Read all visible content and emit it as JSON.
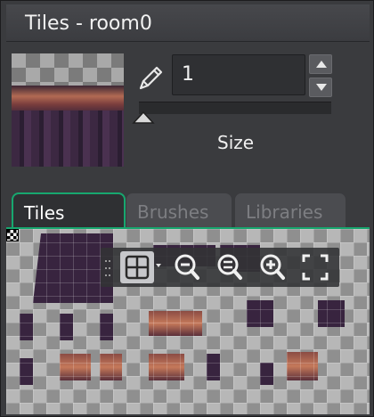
{
  "window": {
    "title": "Tiles - room0"
  },
  "tile_editor": {
    "tile_id": "1",
    "size_label": "Size",
    "size_value": 0.0
  },
  "tabs": [
    {
      "label": "Tiles",
      "active": true
    },
    {
      "label": "Brushes",
      "active": false
    },
    {
      "label": "Libraries",
      "active": false
    }
  ],
  "toolbar": {
    "items": [
      {
        "name": "grid-toggle",
        "icon": "grid-icon",
        "active": true
      },
      {
        "name": "zoom-out",
        "icon": "zoom-out-icon"
      },
      {
        "name": "zoom-reset",
        "icon": "zoom-reset-icon"
      },
      {
        "name": "zoom-in",
        "icon": "zoom-in-icon"
      },
      {
        "name": "fit-view",
        "icon": "fullscreen-icon"
      }
    ]
  },
  "colors": {
    "accent": "#17a76f",
    "panel": "#3a3b3e",
    "field": "#2f3033"
  }
}
